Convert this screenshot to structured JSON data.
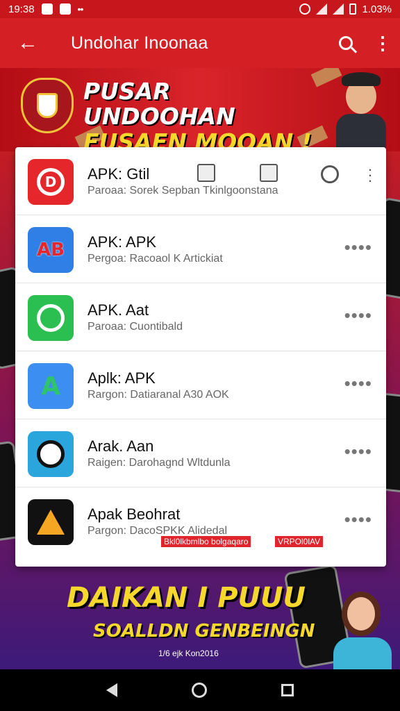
{
  "status_bar": {
    "time": "19:38",
    "dots": "••",
    "battery_text": "1.03%"
  },
  "app_bar": {
    "back_glyph": "←",
    "title": "Undohar Inoonaa",
    "more_glyph": "⋮"
  },
  "banner": {
    "line1": "PUSAR UNDOOHAN",
    "line2": "FUSAEN MOOAN !"
  },
  "apps": [
    {
      "icon": "D",
      "icon_color": "#e5262b",
      "title": "APK: Gtil",
      "subtitle": "Paroaa: Sorek Sepban Tkinlgoonstana",
      "menu": "kebab"
    },
    {
      "icon": "AB",
      "icon_color": "#2f7fe6",
      "title": "APK: APK",
      "subtitle": "Pergoa: Racoaol K Artickiat",
      "menu": "dots"
    },
    {
      "icon": "phone",
      "icon_color": "#2bbf52",
      "title": "APK. Aat",
      "subtitle": "Paroaa: Cuontibald",
      "menu": "dots"
    },
    {
      "icon": "A",
      "icon_color": "#3c8ff0",
      "title": "Aplk: APK",
      "subtitle": "Rargon: Datiaranal A30 AOK",
      "menu": "dots"
    },
    {
      "icon": "ring",
      "icon_color": "#2aa6dc",
      "title": "Arak. Aan",
      "subtitle": "Raigen: Darohagnd Wltdunla",
      "menu": "dots"
    },
    {
      "icon": "peak",
      "icon_color": "#111111",
      "title": "Apak Beohrat",
      "subtitle": "Pargon: DacoSPKK Alidedal",
      "menu": "dots"
    }
  ],
  "more_dots": "••••",
  "warning_labels": [
    "Bkl0lkbmlbo bolgaqaro",
    "VRPOl0lAV"
  ],
  "promo": {
    "line1": "DAIKAN I PUUU",
    "line2": "SOALLDN GENBEINGN",
    "footer": "1/6 ejk Kon2016"
  },
  "colors": {
    "status_red": "#c8171c",
    "appbar_red": "#d41f24",
    "promo_yellow": "#f6d72c"
  },
  "icons": [
    "back-arrow-icon",
    "search-icon",
    "more-vert-icon",
    "copy-icon",
    "document-icon",
    "circle-icon",
    "nav-back-icon",
    "nav-home-icon",
    "nav-recents-icon"
  ]
}
